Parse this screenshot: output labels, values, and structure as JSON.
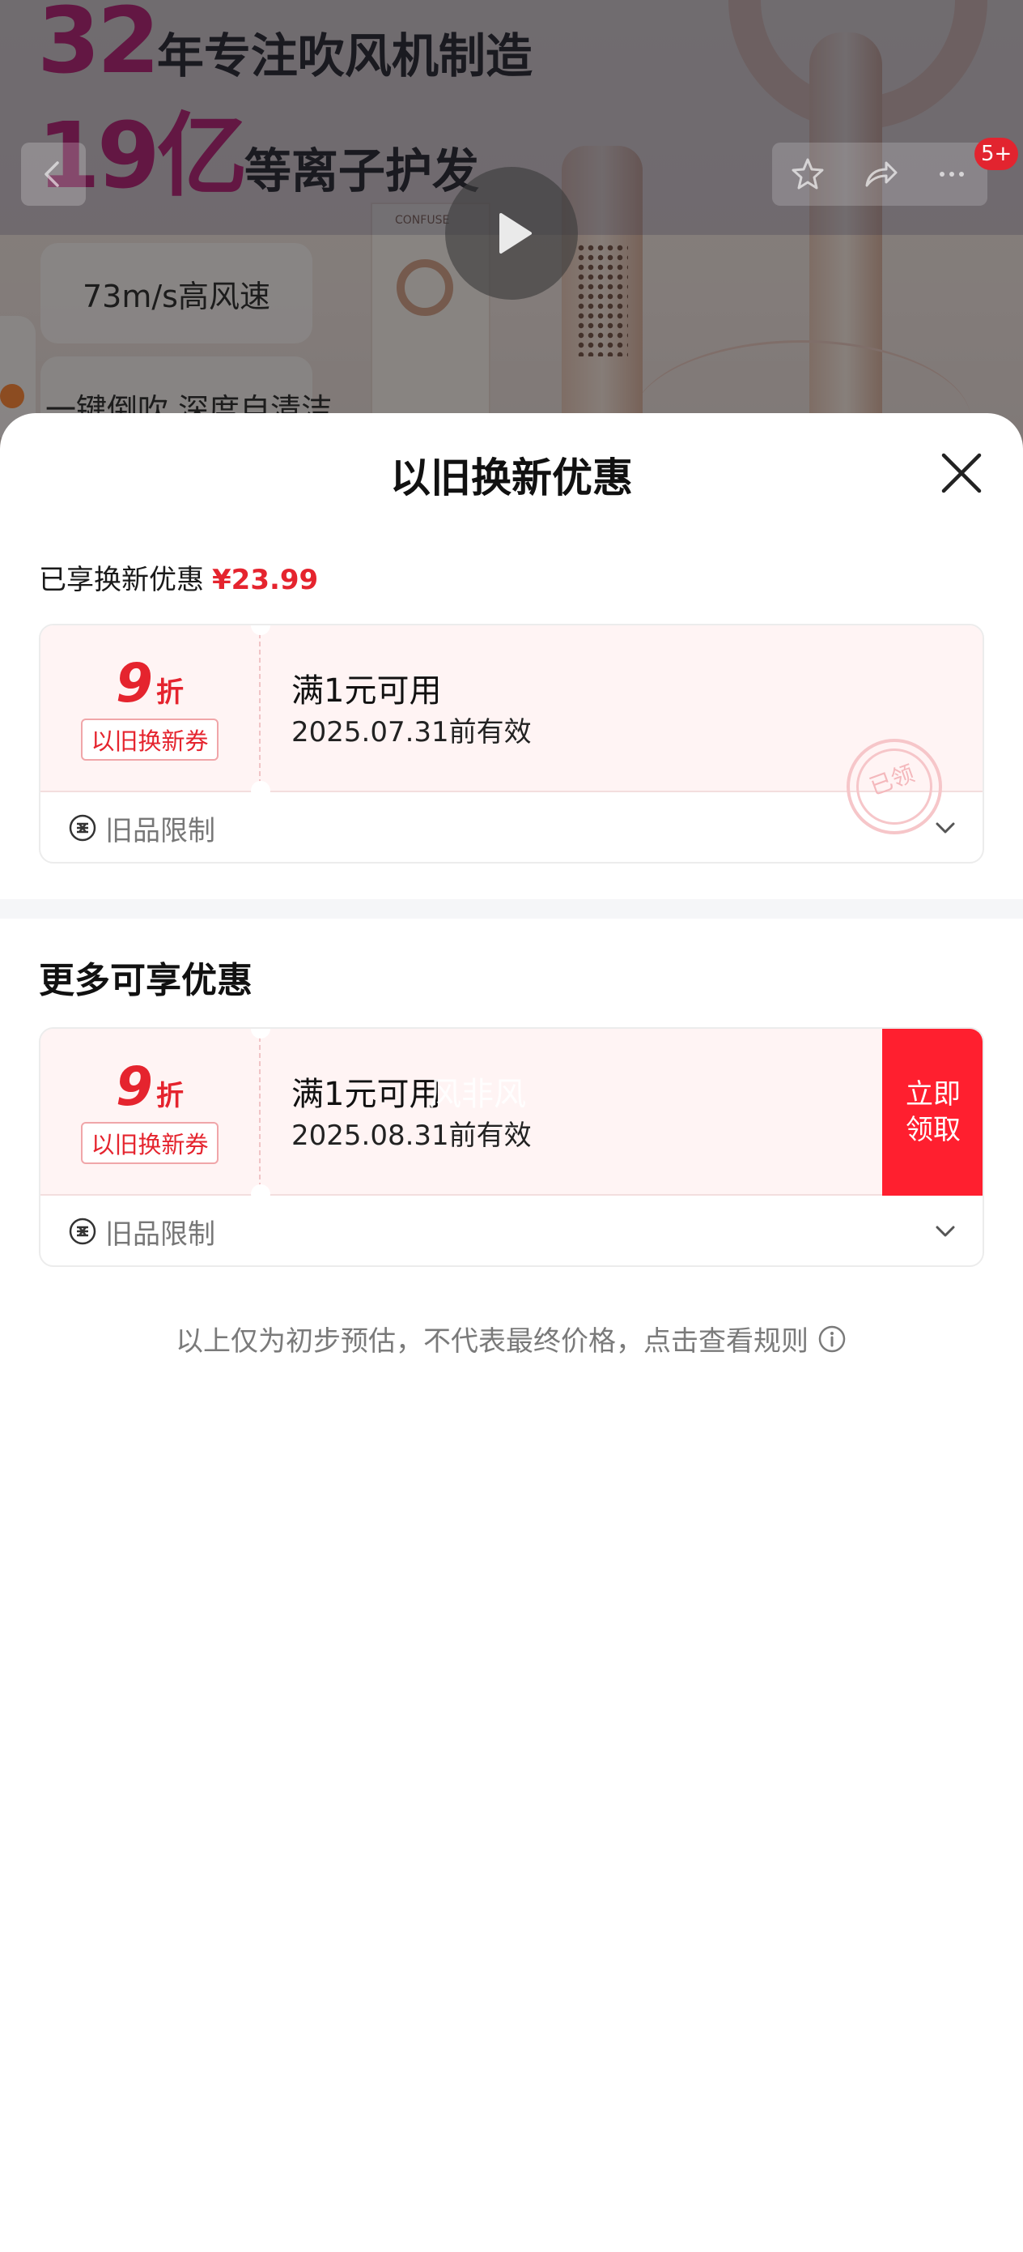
{
  "background_page": {
    "headline_1_number": "32",
    "headline_1_text": "年专注吹风机制造",
    "headline_2_number": "19亿",
    "headline_2_text": "等离子护发",
    "feature_1": "73m/s高风速",
    "feature_2": "一键倒吹 深度自清洁",
    "box_label": "CONFUSE",
    "cart_badge": "5+"
  },
  "sheet": {
    "title": "以旧换新优惠",
    "enjoyed_label": "已享换新优惠",
    "enjoyed_amount": "¥23.99",
    "more_title": "更多可享优惠",
    "footnote": "以上仅为初步预估，不代表最终价格，点击查看规则"
  },
  "applied_coupons": [
    {
      "discount_number": "9",
      "discount_unit": "折",
      "tag": "以旧换新券",
      "condition": "满1元可用",
      "validity": "2025.07.31前有效",
      "stamp": "已领",
      "limit_label": "旧品限制"
    }
  ],
  "more_coupons": [
    {
      "discount_number": "9",
      "discount_unit": "折",
      "tag": "以旧换新券",
      "condition": "满1元可用",
      "validity": "2025.08.31前有效",
      "watermark": "风非风",
      "claim_line1": "立即",
      "claim_line2": "领取",
      "limit_label": "旧品限制"
    }
  ],
  "colors": {
    "accent_red": "#e5242e",
    "claim_red": "#ff1f2f",
    "coupon_bg": "#fff4f4"
  },
  "icons": [
    "back-icon",
    "star-icon",
    "share-icon",
    "more-icon",
    "play-icon",
    "close-icon",
    "badge-icon",
    "chevron-down-icon",
    "info-icon"
  ]
}
